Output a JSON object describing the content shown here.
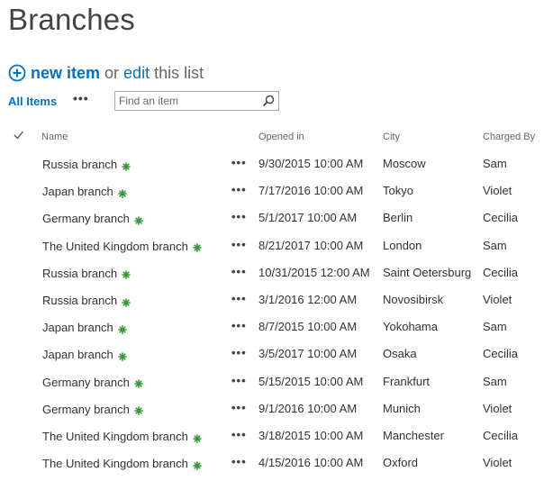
{
  "page": {
    "title": "Branches"
  },
  "toolbar": {
    "new_item_label": "new item",
    "or_label": "or",
    "edit_label": "edit",
    "this_list_label": "this list"
  },
  "view": {
    "all_items_label": "All Items",
    "ellipsis": "•••",
    "search_placeholder": "Find an item"
  },
  "table": {
    "headers": {
      "check": "✓",
      "name": "Name",
      "opened_in": "Opened in",
      "city": "City",
      "charged_by": "Charged By"
    },
    "row_ellipsis": "•••",
    "rows": [
      {
        "name": "Russia branch",
        "opened_in": "9/30/2015 10:00 AM",
        "city": "Moscow",
        "charged_by": "Sam"
      },
      {
        "name": "Japan branch",
        "opened_in": "7/17/2016 10:00 AM",
        "city": "Tokyo",
        "charged_by": "Violet"
      },
      {
        "name": "Germany branch",
        "opened_in": "5/1/2017 10:00 AM",
        "city": "Berlin",
        "charged_by": "Cecilia"
      },
      {
        "name": "The United Kingdom branch",
        "opened_in": "8/21/2017 10:00 AM",
        "city": "London",
        "charged_by": "Sam"
      },
      {
        "name": "Russia branch",
        "opened_in": "10/31/2015 12:00 AM",
        "city": "Saint Oetersburg",
        "charged_by": "Cecilia"
      },
      {
        "name": "Russia branch",
        "opened_in": "3/1/2016 12:00 AM",
        "city": "Novosibirsk",
        "charged_by": "Violet"
      },
      {
        "name": "Japan branch",
        "opened_in": "8/7/2015 10:00 AM",
        "city": "Yokohama",
        "charged_by": "Sam"
      },
      {
        "name": "Japan branch",
        "opened_in": "3/5/2017 10:00 AM",
        "city": "Osaka",
        "charged_by": "Cecilia"
      },
      {
        "name": "Germany branch",
        "opened_in": "5/15/2015 10:00 AM",
        "city": "Frankfurt",
        "charged_by": "Sam"
      },
      {
        "name": "Germany branch",
        "opened_in": "9/1/2016 10:00 AM",
        "city": "Munich",
        "charged_by": "Violet"
      },
      {
        "name": "The United Kingdom branch",
        "opened_in": "3/18/2015 10:00 AM",
        "city": "Manchester",
        "charged_by": "Cecilia"
      },
      {
        "name": "The United Kingdom branch",
        "opened_in": "4/15/2016 10:00 AM",
        "city": "Oxford",
        "charged_by": "Violet"
      }
    ]
  },
  "colors": {
    "link_blue": "#0072c6",
    "new_badge_green": "#339933",
    "text": "#333333",
    "muted": "#666666"
  },
  "icons": {
    "add": "plus-circle-icon",
    "search": "magnifier-icon",
    "new_item_badge": "new-asterisk-icon",
    "select_all": "checkmark-icon"
  }
}
